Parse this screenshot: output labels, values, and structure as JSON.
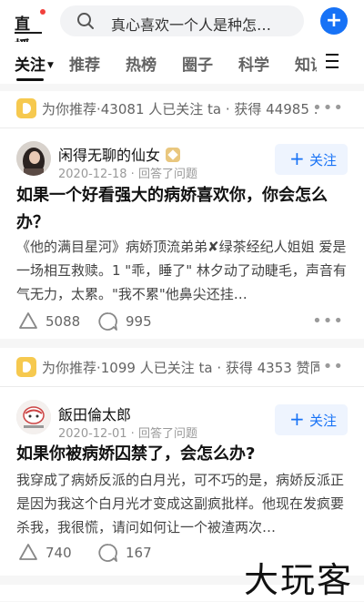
{
  "app": {
    "logo_text": "直播"
  },
  "search": {
    "query": "真心喜欢一个人是种怎…"
  },
  "tabs": [
    {
      "label": "关注",
      "active": true
    },
    {
      "label": "推荐",
      "active": false
    },
    {
      "label": "热榜",
      "active": false
    },
    {
      "label": "圈子",
      "active": false
    },
    {
      "label": "科学",
      "active": false
    },
    {
      "label": "知识",
      "active": false
    }
  ],
  "cards": [
    {
      "recommend_text": "为你推荐·43081 人已关注 ta · 获得 44985 …",
      "author": "闲得无聊的仙女",
      "meta": "2020-12-18 · 回答了问题",
      "follow_label": "关注",
      "title": "如果一个好看强大的病娇喜欢你，你会怎么办？",
      "excerpt": "《他的满目星河》病娇顶流弟弟✘绿茶经纪人姐姐 爱是一场相互救赎。1 \"乖，睡了\" 林夕动了动睫毛，声音有气无力，太累。\"我不累\"他鼻尖还挂…",
      "upvotes": "5088",
      "comments": "995"
    },
    {
      "recommend_text": "为你推荐·1099 人已关注 ta · 获得 4353 赞同",
      "author": "飯田倫太郎",
      "meta": "2020-12-01 · 回答了问题",
      "follow_label": "关注",
      "title": "如果你被病娇囚禁了，会怎么办?",
      "excerpt": "我穿成了病娇反派的白月光，可不巧的是，病娇反派正是因为我这个白月光才变成这副疯批样。他现在发疯要杀我，我很慌，请问如何让一个被渣两次…",
      "upvotes": "740",
      "comments": "167"
    }
  ],
  "watermark": "大玩客",
  "colors": {
    "accent": "#1772f6",
    "badge": "#f6c94f",
    "logo_dot": "#f1403c"
  },
  "icons": [
    "search-icon",
    "plus-icon",
    "menu-icon",
    "recommend-icon",
    "more-icon",
    "upvote-icon",
    "comment-icon"
  ]
}
